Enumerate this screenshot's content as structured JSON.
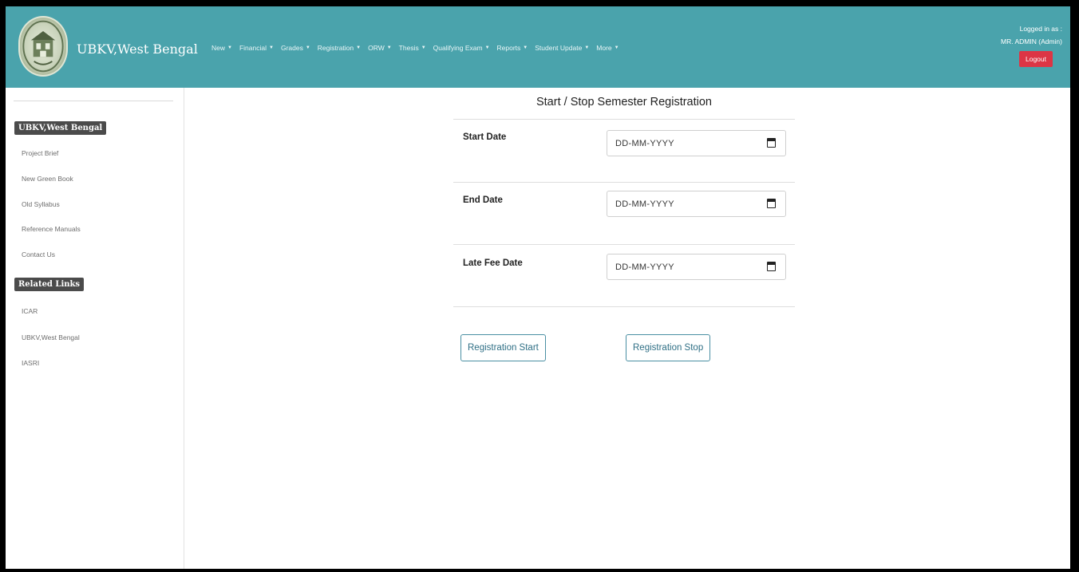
{
  "header": {
    "brand": "UBKV,West Bengal",
    "logo_icon": "university-seal-icon",
    "nav": [
      {
        "label": "New"
      },
      {
        "label": "Financial"
      },
      {
        "label": "Grades"
      },
      {
        "label": "Registration"
      },
      {
        "label": "ORW"
      },
      {
        "label": "Thesis"
      },
      {
        "label": "Qualifying Exam"
      },
      {
        "label": "Reports"
      },
      {
        "label": "Student Update"
      },
      {
        "label": "More"
      }
    ],
    "logged_in_label": "Logged in as :",
    "user": "MR. ADMIN (Admin)",
    "logout_label": "Logout"
  },
  "sidebar": {
    "heading1": "UBKV,West Bengal",
    "links1": [
      "Project Brief",
      "New Green Book",
      "Old Syllabus",
      "Reference Manuals",
      "Contact Us"
    ],
    "heading2": "Related Links",
    "links2": [
      "ICAR",
      "UBKV,West Bengal",
      "IASRI"
    ]
  },
  "form": {
    "title": "Start / Stop Semester Registration",
    "fields": [
      {
        "label": "Start Date",
        "placeholder": "DD-MM-YYYY"
      },
      {
        "label": "End Date",
        "placeholder": "DD-MM-YYYY"
      },
      {
        "label": "Late Fee Date",
        "placeholder": "DD-MM-YYYY"
      }
    ],
    "start_button": "Registration Start",
    "stop_button": "Registration Stop"
  },
  "colors": {
    "header_bg": "#4aa3ac",
    "logout_bg": "#dc3545",
    "sidebar_heading_bg": "#4b4b4b",
    "button_border": "#4a8fa3"
  }
}
